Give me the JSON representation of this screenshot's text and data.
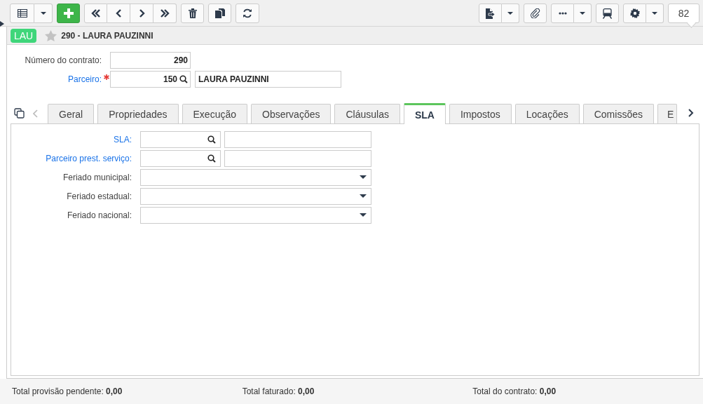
{
  "toolbar": {
    "counter": "82"
  },
  "record": {
    "badge": "LAU",
    "title": "290 - LAURA PAUZINNI",
    "favorite": false
  },
  "form": {
    "fields": [
      {
        "label": "Número do contrato:",
        "value": "290",
        "link": false,
        "required": false
      },
      {
        "label": "Parceiro:",
        "value": "150",
        "link": true,
        "required": true,
        "description": "LAURA PAUZINNI"
      }
    ]
  },
  "tabs": [
    {
      "label": "Geral",
      "selected": false
    },
    {
      "label": "Propriedades",
      "selected": false
    },
    {
      "label": "Execução",
      "selected": false
    },
    {
      "label": "Observações",
      "selected": false
    },
    {
      "label": "Cláusulas",
      "selected": false
    },
    {
      "label": "SLA",
      "selected": true
    },
    {
      "label": "Impostos",
      "selected": false
    },
    {
      "label": "Locações",
      "selected": false
    },
    {
      "label": "Comissões",
      "selected": false
    },
    {
      "label": "E",
      "selected": false
    }
  ],
  "sla": {
    "fields": [
      {
        "label": "SLA:",
        "kind": "lookup",
        "link": true
      },
      {
        "label": "Parceiro prest. serviço:",
        "kind": "lookup",
        "link": true
      },
      {
        "label": "Feriado municipal:",
        "kind": "select",
        "link": false
      },
      {
        "label": "Feriado estadual:",
        "kind": "select",
        "link": false
      },
      {
        "label": "Feriado nacional:",
        "kind": "select",
        "link": false
      }
    ]
  },
  "totals": [
    {
      "label": "Total provisão pendente:",
      "value": "0,00"
    },
    {
      "label": "Total faturado:",
      "value": "0,00"
    },
    {
      "label": "Total do contrato:",
      "value": "0,00"
    }
  ]
}
